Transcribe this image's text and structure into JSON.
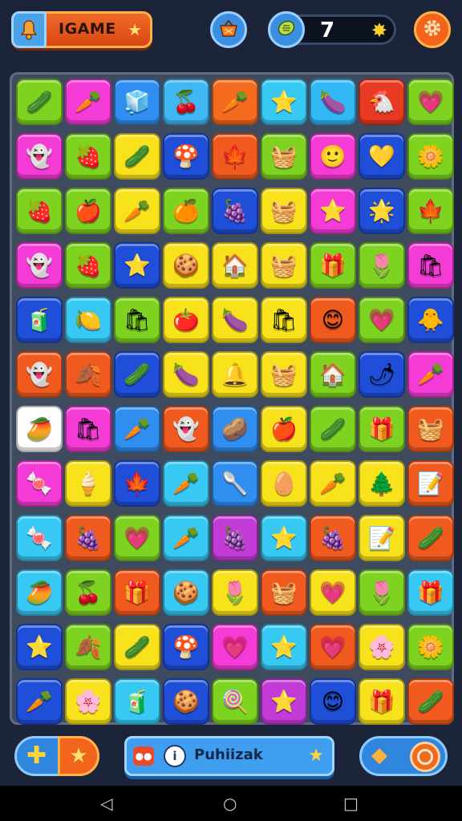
{
  "header": {
    "title": "IGAME",
    "score": "7",
    "icons": {
      "title": "bell-icon",
      "title_star": "star-icon",
      "basket": "basket-icon",
      "coin": "coin-icon",
      "counter_burst": "sun-burst-icon",
      "settings": "gear-icon"
    }
  },
  "board": {
    "rows": [
      [
        [
          "#7ed321",
          "🥒"
        ],
        [
          "#f43bd6",
          "🥕"
        ],
        [
          "#2f8ef0",
          "🧊"
        ],
        [
          "#3fb7f2",
          "🍒"
        ],
        [
          "#f46a1e",
          "🥕"
        ],
        [
          "#38c8f4",
          "⭐"
        ],
        [
          "#32b8f4",
          "🍆"
        ],
        [
          "#e83a22",
          "🐔"
        ],
        [
          "#7ed321",
          "💗"
        ]
      ],
      [
        [
          "#f43bd6",
          "👻"
        ],
        [
          "#7ed321",
          "🍓"
        ],
        [
          "#f7e21b",
          "🥒"
        ],
        [
          "#1f4fd8",
          "🍄"
        ],
        [
          "#f05a1e",
          "🍁"
        ],
        [
          "#7ed321",
          "🧺"
        ],
        [
          "#f43bd6",
          "🙂"
        ],
        [
          "#1f4fd8",
          "💛"
        ],
        [
          "#7ed321",
          "🌼"
        ]
      ],
      [
        [
          "#7ed321",
          "🍓"
        ],
        [
          "#7ed321",
          "🍎"
        ],
        [
          "#f7e21b",
          "🥕"
        ],
        [
          "#7ed321",
          "🍊"
        ],
        [
          "#1f4fd8",
          "🍇"
        ],
        [
          "#f7e21b",
          "🧺"
        ],
        [
          "#f43bd6",
          "⭐"
        ],
        [
          "#1f4fd8",
          "🌟"
        ],
        [
          "#7ed321",
          "🍁"
        ]
      ],
      [
        [
          "#f43bd6",
          "👻"
        ],
        [
          "#7ed321",
          "🍓"
        ],
        [
          "#1f4fd8",
          "⭐"
        ],
        [
          "#f7e21b",
          "🍪"
        ],
        [
          "#f7e21b",
          "🏠"
        ],
        [
          "#f7e21b",
          "🧺"
        ],
        [
          "#7ed321",
          "🎁"
        ],
        [
          "#7ed321",
          "🌷"
        ],
        [
          "#f43bd6",
          "🛍"
        ]
      ],
      [
        [
          "#1f4fd8",
          "🧃"
        ],
        [
          "#38c8f4",
          "🍋"
        ],
        [
          "#7ed321",
          "🛍"
        ],
        [
          "#f7e21b",
          "🍅"
        ],
        [
          "#f7e21b",
          "🍆"
        ],
        [
          "#f7e21b",
          "🛍"
        ],
        [
          "#f05a1e",
          "😊"
        ],
        [
          "#7ed321",
          "💗"
        ],
        [
          "#1f4fd8",
          "🐥"
        ]
      ],
      [
        [
          "#f05a1e",
          "👻"
        ],
        [
          "#f05a1e",
          "🍂"
        ],
        [
          "#1f4fd8",
          "🥒"
        ],
        [
          "#f7e21b",
          "🍆"
        ],
        [
          "#f7e21b",
          "🔔"
        ],
        [
          "#f7e21b",
          "🧺"
        ],
        [
          "#7ed321",
          "🏠"
        ],
        [
          "#1f4fd8",
          "🌶"
        ],
        [
          "#f43bd6",
          "🥕"
        ]
      ],
      [
        [
          "#ffffff",
          "🥭"
        ],
        [
          "#f43bd6",
          "🛍"
        ],
        [
          "#2f8ef0",
          "🥕"
        ],
        [
          "#f05a1e",
          "👻"
        ],
        [
          "#2f8ef0",
          "🥔"
        ],
        [
          "#f7e21b",
          "🍎"
        ],
        [
          "#7ed321",
          "🥒"
        ],
        [
          "#7ed321",
          "🎁"
        ],
        [
          "#f05a1e",
          "🧺"
        ]
      ],
      [
        [
          "#f43bd6",
          "🍬"
        ],
        [
          "#f7e21b",
          "🍦"
        ],
        [
          "#1f4fd8",
          "🍁"
        ],
        [
          "#38c8f4",
          "🥕"
        ],
        [
          "#2f8ef0",
          "🥄"
        ],
        [
          "#f7e21b",
          "🥚"
        ],
        [
          "#f7e21b",
          "🥕"
        ],
        [
          "#f7e21b",
          "🌲"
        ],
        [
          "#f05a1e",
          "📝"
        ]
      ],
      [
        [
          "#38c8f4",
          "🍬"
        ],
        [
          "#f05a1e",
          "🍇"
        ],
        [
          "#7ed321",
          "💗"
        ],
        [
          "#38c8f4",
          "🥕"
        ],
        [
          "#c23bd6",
          "🍇"
        ],
        [
          "#38c8f4",
          "⭐"
        ],
        [
          "#f05a1e",
          "🍇"
        ],
        [
          "#f7e21b",
          "📝"
        ],
        [
          "#f05a1e",
          "🥒"
        ]
      ],
      [
        [
          "#38c8f4",
          "🥭"
        ],
        [
          "#7ed321",
          "🍒"
        ],
        [
          "#f05a1e",
          "🎁"
        ],
        [
          "#38c8f4",
          "🍪"
        ],
        [
          "#f7e21b",
          "🌷"
        ],
        [
          "#f05a1e",
          "🧺"
        ],
        [
          "#f7e21b",
          "💗"
        ],
        [
          "#7ed321",
          "🌷"
        ],
        [
          "#38c8f4",
          "🎁"
        ]
      ],
      [
        [
          "#1f4fd8",
          "⭐"
        ],
        [
          "#7ed321",
          "🍂"
        ],
        [
          "#f7e21b",
          "🥒"
        ],
        [
          "#1f4fd8",
          "🍄"
        ],
        [
          "#f43bd6",
          "💗"
        ],
        [
          "#38c8f4",
          "⭐"
        ],
        [
          "#f05a1e",
          "💗"
        ],
        [
          "#f7e21b",
          "🌸"
        ],
        [
          "#7ed321",
          "🌼"
        ]
      ],
      [
        [
          "#1f4fd8",
          "🥕"
        ],
        [
          "#f7e21b",
          "🌸"
        ],
        [
          "#38c8f4",
          "🧃"
        ],
        [
          "#1f4fd8",
          "🍪"
        ],
        [
          "#7ed321",
          "🍭"
        ],
        [
          "#c23bd6",
          "⭐"
        ],
        [
          "#1f4fd8",
          "😊"
        ],
        [
          "#f7e21b",
          "🎁"
        ],
        [
          "#f05a1e",
          "🥒"
        ]
      ]
    ]
  },
  "footer": {
    "hint_label": "Puhiizak",
    "info_glyph": "i",
    "icons": {
      "add": "plus-icon",
      "star": "star-icon",
      "face": "face-icon",
      "info": "info-icon",
      "hint_star": "star-icon",
      "cube": "cube-icon",
      "target": "target-icon"
    }
  },
  "system_nav": {
    "back": "◁",
    "home": "○",
    "recent": "□"
  }
}
